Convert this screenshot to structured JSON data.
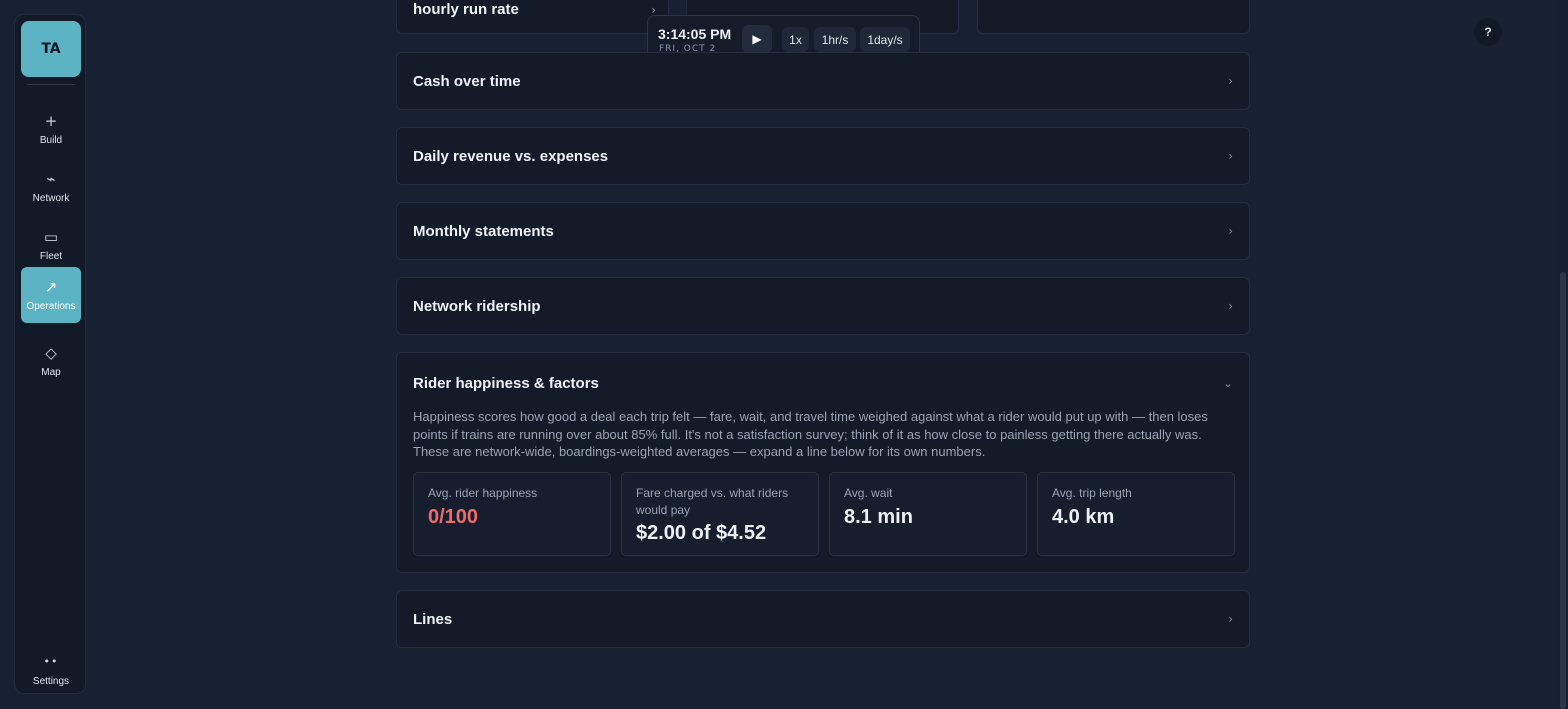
{
  "sidebar": {
    "avatar": "TA",
    "items": [
      {
        "icon": "+",
        "label": "Build"
      },
      {
        "icon": "⌁",
        "label": "Network"
      },
      {
        "icon": "▭",
        "label": "Fleet"
      },
      {
        "icon": "↗",
        "label": "Operations"
      },
      {
        "icon": "◇",
        "label": "Map"
      },
      {
        "icon": "••",
        "label": "Settings"
      }
    ],
    "active": "Operations"
  },
  "top_cards": {
    "first_title": "hourly run rate",
    "first_chevron": "›"
  },
  "clock": {
    "time": "3:14:05 PM",
    "date": "FRI, OCT 2",
    "play_icon": "▶",
    "speeds": [
      "1x",
      "1hr/s",
      "1day/s"
    ]
  },
  "help": "?",
  "sections": {
    "cash": {
      "title": "Cash over time",
      "chevron": "›"
    },
    "revenue": {
      "title": "Daily revenue vs. expenses",
      "chevron": "›"
    },
    "monthly": {
      "title": "Monthly statements",
      "chevron": "›"
    },
    "ridership": {
      "title": "Network ridership",
      "chevron": "›"
    },
    "happiness": {
      "title": "Rider happiness & factors",
      "chevron": "⌄",
      "description": "Happiness scores how good a deal each trip felt — fare, wait, and travel time weighed against what a rider would put up with — then loses points if trains are running over about 85% full. It's not a satisfaction survey; think of it as how close to painless getting there actually was. These are network-wide, boardings-weighted averages — expand a line below for its own numbers.",
      "metrics": [
        {
          "label": "Avg. rider happiness",
          "value": "0/100"
        },
        {
          "label": "Fare charged vs. what riders would pay",
          "value": "$2.00 of $4.52"
        },
        {
          "label": "Avg. wait",
          "value": "8.1 min"
        },
        {
          "label": "Avg. trip length",
          "value": "4.0 km"
        }
      ]
    },
    "lines": {
      "title": "Lines",
      "chevron": "›"
    }
  },
  "colors": {
    "accent": "#5bb3c3",
    "bad": "#ee6b6b",
    "background": "#182132",
    "card": "#131a28"
  }
}
